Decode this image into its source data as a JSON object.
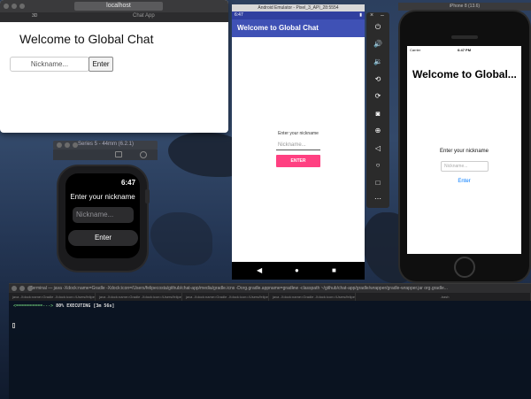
{
  "browser": {
    "url": "localhost",
    "tab_title": "Chat App",
    "devtools_label": "3D",
    "heading": "Welcome to Global Chat",
    "nickname_placeholder": "Nickname...",
    "enter_label": "Enter"
  },
  "watch": {
    "window_title": "Series 5 - 44mm (6.2.1)",
    "time": "6:47",
    "prompt": "Enter your nickname",
    "nickname_placeholder": "Nickname...",
    "enter_label": "Enter"
  },
  "android": {
    "window_title": "Android Emulator - Pixel_3_API_28:5554",
    "status_time": "6:47",
    "app_title": "Welcome to Global Chat",
    "prompt": "Enter your nickname",
    "nickname_placeholder": "Nickname...",
    "enter_label": "ENTER",
    "accent_color": "#ff4081",
    "primary_color": "#3f51b5",
    "toolbar_icons": [
      "power-icon",
      "volume-up-icon",
      "volume-down-icon",
      "rotate-left-icon",
      "rotate-right-icon",
      "camera-icon",
      "zoom-in-icon",
      "back-icon",
      "home-icon",
      "overview-icon",
      "more-icon"
    ],
    "nav_back_glyph": "◀",
    "nav_home_glyph": "●",
    "nav_overview_glyph": "■"
  },
  "emulator_controls": {
    "close_glyph": "×",
    "minimize_glyph": "–"
  },
  "iphone": {
    "window_title": "iPhone 8 (13.6)",
    "carrier": "Carrier",
    "status_time": "6:47 PM",
    "title": "Welcome to Global...",
    "prompt": "Enter your nickname",
    "nickname_placeholder": "Nickname...",
    "enter_label": "Enter",
    "link_color": "#007aff"
  },
  "terminal": {
    "window_title": "Terminal — java -Xdock:name=Gradle -Xdock:icon=/Users/felipecosta/github/chat-app/media/gradle.icns -Dorg.gradle.appname=gradlew -classpath ~/github/chat-app/gradle/wrapper/gradle-wrapper.jar org.gradle...",
    "tabs": [
      "java -Xdock:name=Gradle -Xdock:icon=/Users/felipecosta/github/chat-ap...",
      "java -Xdock:name=Gradle -Xdock:icon=/Users/felipecosta/github/chat-ap...",
      "java -Xdock:name=Gradle -Xdock:icon=/Users/felipecosta/github/chat-ap...",
      "java -Xdock:name=Gradle -Xdock:icon=/Users/felipecosta/github/chat-ap...",
      "-bash"
    ],
    "progress_bar": "<==========---> ",
    "progress_text": "80% EXECUTING [3m 56s]"
  }
}
